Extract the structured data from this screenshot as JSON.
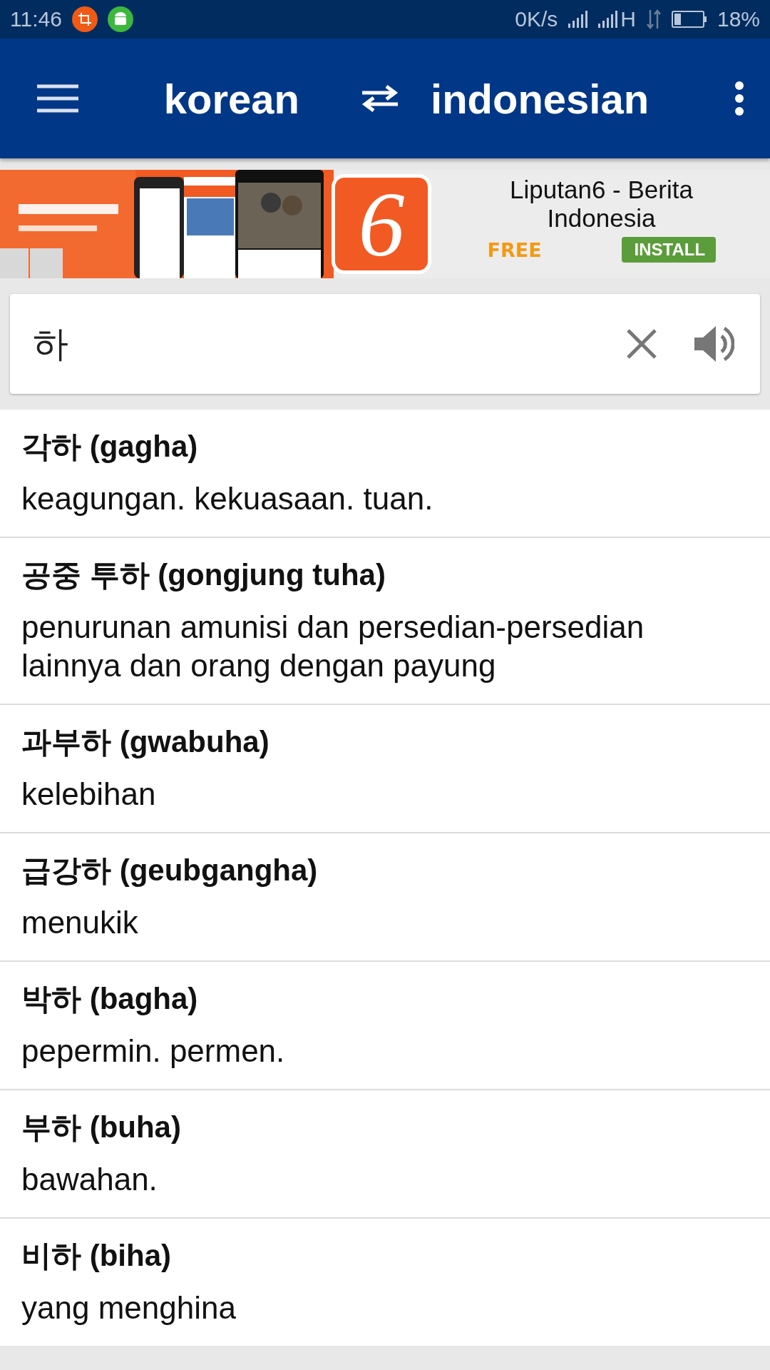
{
  "status_bar": {
    "time": "11:46",
    "speed": "0K/s",
    "network": "H",
    "battery": "18%"
  },
  "app_bar": {
    "source_language": "korean",
    "target_language": "indonesian"
  },
  "ad": {
    "kind": "picture",
    "icon_text": "6",
    "title": "Liputan6 - Berita Indonesia",
    "price": "FREE",
    "install": "INSTALL"
  },
  "search": {
    "value": "하"
  },
  "results": [
    {
      "term": "각하 (gagha)",
      "meaning": "keagungan. kekuasaan. tuan."
    },
    {
      "term": "공중 투하 (gongjung tuha)",
      "meaning": "penurunan amunisi dan persedian-persedian lainnya dan orang dengan payung"
    },
    {
      "term": "과부하 (gwabuha)",
      "meaning": "kelebihan"
    },
    {
      "term": "급강하 (geubgangha)",
      "meaning": "menukik"
    },
    {
      "term": "박하 (bagha)",
      "meaning": "pepermin. permen."
    },
    {
      "term": "부하 (buha)",
      "meaning": "bawahan."
    },
    {
      "term": "비하 (biha)",
      "meaning": "yang menghina"
    }
  ]
}
